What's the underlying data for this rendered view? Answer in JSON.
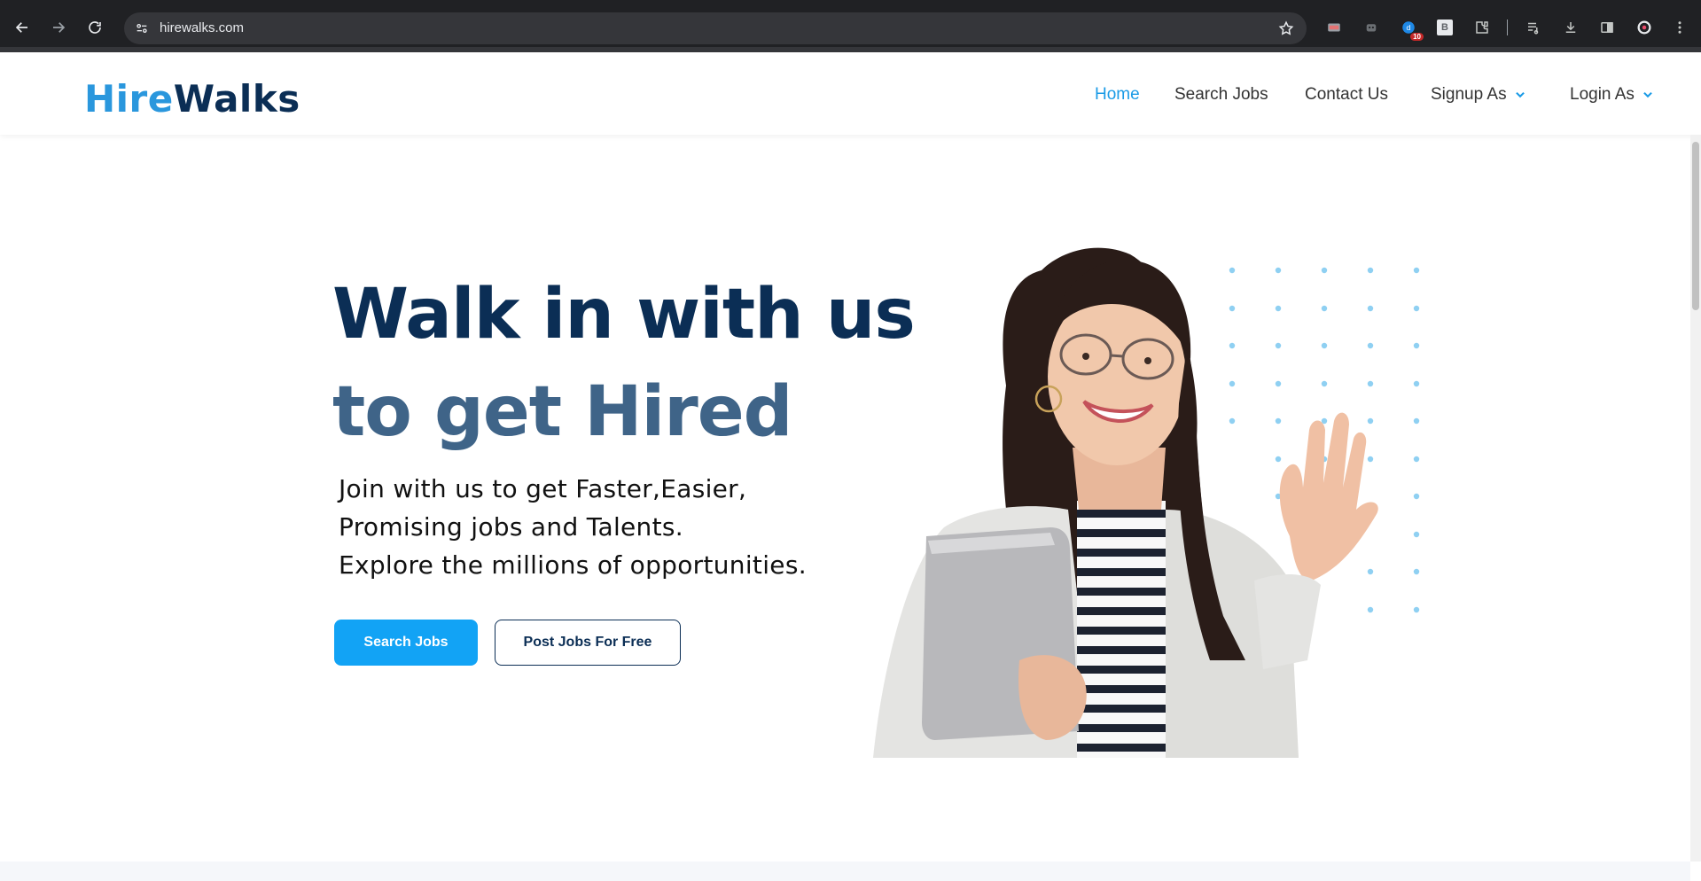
{
  "browser": {
    "url": "hirewalks.com",
    "extension_badge": "10",
    "extension_b_label": "B"
  },
  "site": {
    "logo_part1": "Hire",
    "logo_part2": "Walks",
    "nav": {
      "home": "Home",
      "search_jobs": "Search Jobs",
      "contact_us": "Contact Us",
      "signup_as": "Signup As",
      "login_as": "Login As"
    }
  },
  "hero": {
    "title_line1": "Walk in with us",
    "title_line2": "to get Hired",
    "subtitle_line1": "Join with us to get Faster,Easier,",
    "subtitle_line2": "Promising jobs and Talents.",
    "subtitle_line3": "Explore the millions of opportunities.",
    "primary_button": "Search Jobs",
    "secondary_button": "Post Jobs For Free"
  },
  "colors": {
    "brand_light": "#2a97dd",
    "brand_dark": "#0b2e55",
    "accent": "#12a3f5",
    "title_secondary": "#3f6488"
  },
  "icons": [
    "back-icon",
    "forward-icon",
    "reload-icon",
    "site-info-icon",
    "bookmark-star-icon",
    "extension-icon",
    "download-icon",
    "sidebar-icon",
    "profile-icon",
    "menu-icon",
    "chevron-down-icon"
  ]
}
